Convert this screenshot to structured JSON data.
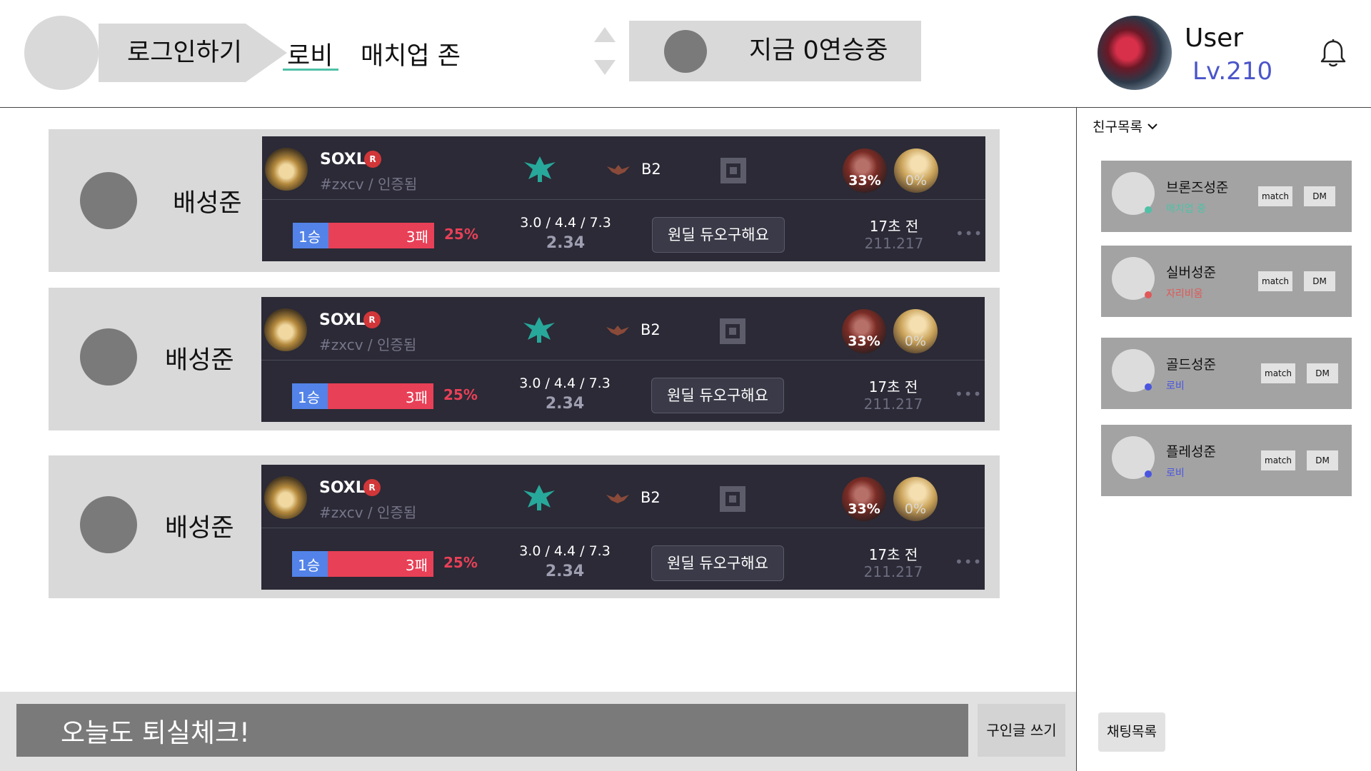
{
  "header": {
    "login_label": "로그인하기",
    "nav_lobby": "로비",
    "nav_match": "매치업 존",
    "streak_text": "지금 0연승중",
    "user_name": "User",
    "user_level": "Lv.210"
  },
  "posts": [
    {
      "author": "배성준",
      "player_name": "SOXL",
      "player_tag": "#zxcv / 인증됨",
      "tier": "B2",
      "champ_a_rate": "33%",
      "champ_b_rate": "0%",
      "wins": "1승",
      "losses": "3패",
      "winrate": "25%",
      "winrate_value": 0.25,
      "kda": "3.0 / 4.4 / 7.3",
      "kda_ratio": "2.34",
      "request": "원딜 듀오구해요",
      "time": "17초 전",
      "ip": "211.217"
    },
    {
      "author": "배성준",
      "player_name": "SOXL",
      "player_tag": "#zxcv / 인증됨",
      "tier": "B2",
      "champ_a_rate": "33%",
      "champ_b_rate": "0%",
      "wins": "1승",
      "losses": "3패",
      "winrate": "25%",
      "winrate_value": 0.25,
      "kda": "3.0 / 4.4 / 7.3",
      "kda_ratio": "2.34",
      "request": "원딜 듀오구해요",
      "time": "17초 전",
      "ip": "211.217"
    },
    {
      "author": "배성준",
      "player_name": "SOXL",
      "player_tag": "#zxcv / 인증됨",
      "tier": "B2",
      "champ_a_rate": "33%",
      "champ_b_rate": "0%",
      "wins": "1승",
      "losses": "3패",
      "winrate": "25%",
      "winrate_value": 0.25,
      "kda": "3.0 / 4.4 / 7.3",
      "kda_ratio": "2.34",
      "request": "원딜 듀오구해요",
      "time": "17초 전",
      "ip": "211.217"
    }
  ],
  "sidebar": {
    "friends_label": "친구목록",
    "chat_list_label": "채팅목록",
    "match_label": "match",
    "dm_label": "DM",
    "friends": [
      {
        "name": "브론즈성준",
        "status": "매치업 중",
        "status_color": "#4fc1a6"
      },
      {
        "name": "실버성준",
        "status": "자리비움",
        "status_color": "#e05858"
      },
      {
        "name": "골드성준",
        "status": "로비",
        "status_color": "#4a55e0"
      },
      {
        "name": "플레성준",
        "status": "로비",
        "status_color": "#4a55e0"
      }
    ]
  },
  "bottom": {
    "check_value": "오늘도 퇴실체크!",
    "write_label": "구인글 쓰기"
  },
  "colors": {
    "accent_underline": "#4fc1a6",
    "level": "#4a55c9",
    "win": "#5383e8",
    "loss": "#e84057",
    "panel": "#2b2a36"
  }
}
